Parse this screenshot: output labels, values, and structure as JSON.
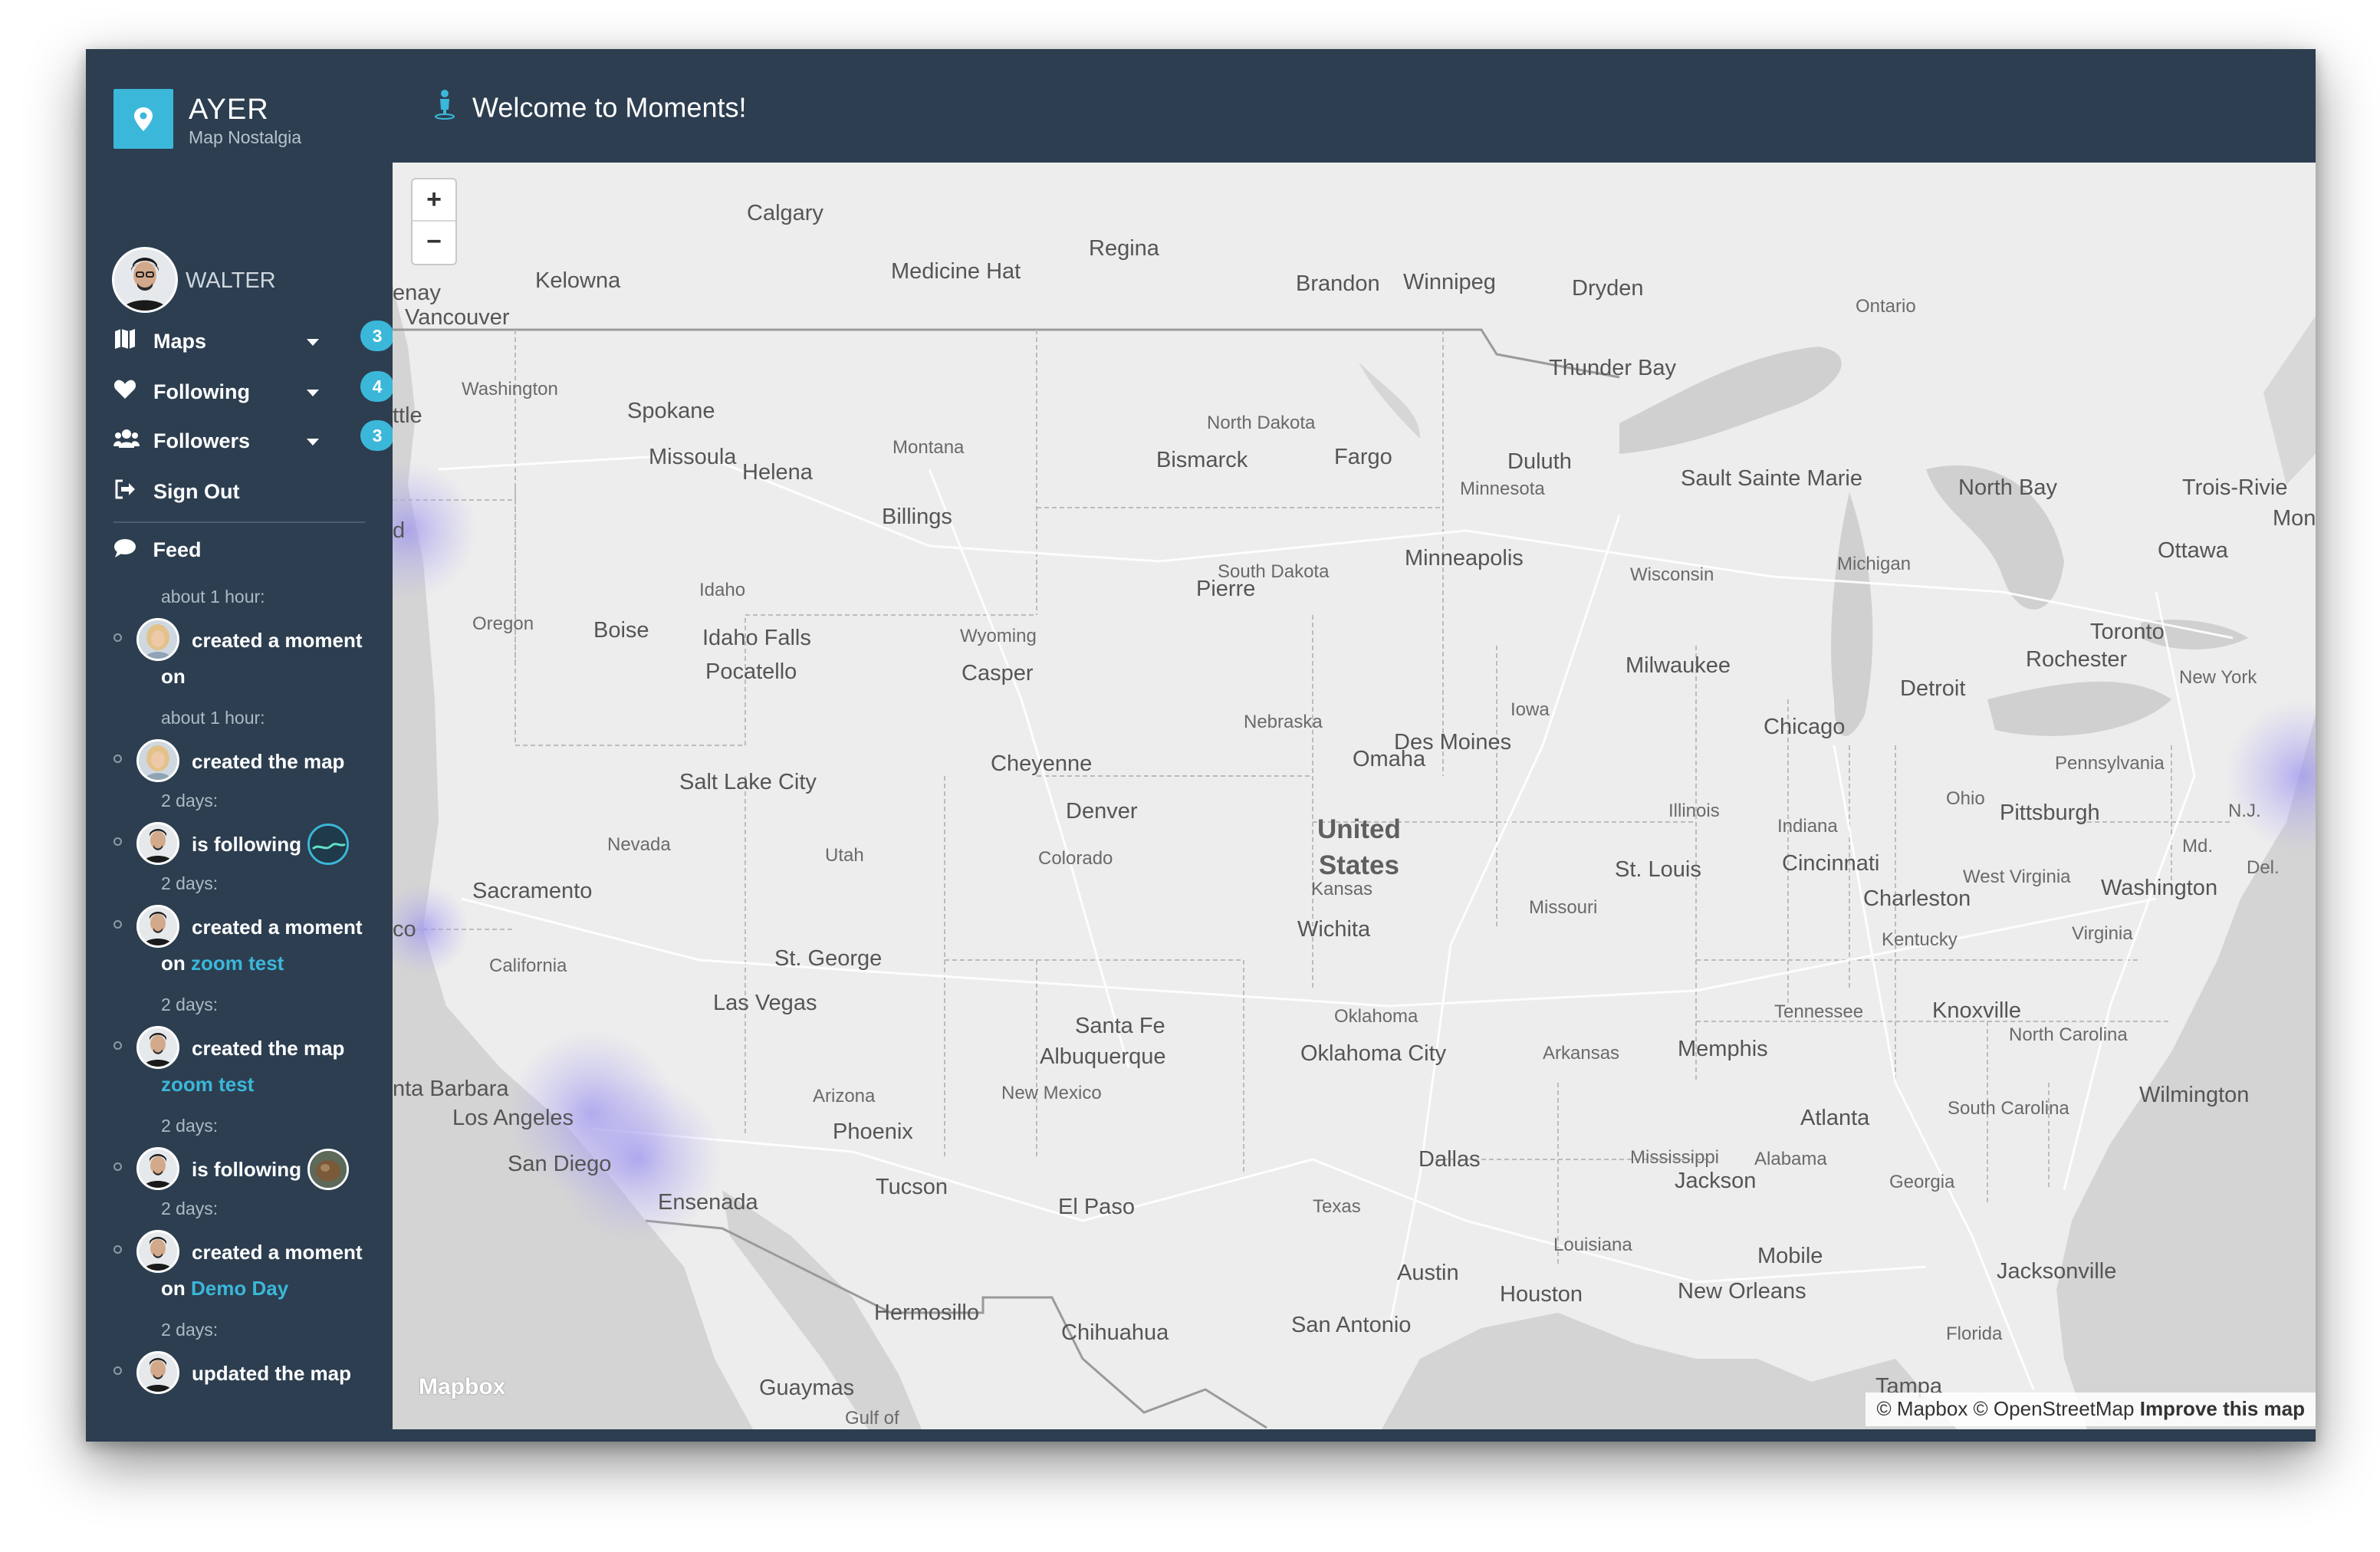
{
  "brand": {
    "title": "AYER",
    "subtitle": "Map Nostalgia"
  },
  "header": {
    "title": "Welcome to Moments!",
    "icon": "person-icon"
  },
  "user": {
    "name": "WALTER"
  },
  "nav": [
    {
      "label": "Maps",
      "icon": "map-icon",
      "badge": "3",
      "has_dropdown": true
    },
    {
      "label": "Following",
      "icon": "heart-icon",
      "badge": "4",
      "has_dropdown": true
    },
    {
      "label": "Followers",
      "icon": "users-icon",
      "badge": "3",
      "has_dropdown": true
    },
    {
      "label": "Sign Out",
      "icon": "sign-out-icon"
    }
  ],
  "feed": {
    "title": "Feed",
    "entries": [
      {
        "time": "about 1 hour:",
        "text": "created a moment",
        "line2": "on",
        "link": ""
      },
      {
        "time": "about 1 hour:",
        "text": "created the map",
        "line2": "",
        "link": ""
      },
      {
        "time": "2 days:",
        "text": "is following",
        "line2": "",
        "link": ""
      },
      {
        "time": "2 days:",
        "text": "created a moment",
        "line2": "on ",
        "link": "zoom test"
      },
      {
        "time": "2 days:",
        "text": "created the map",
        "line2": "",
        "link": "zoom test"
      },
      {
        "time": "2 days:",
        "text": "is following",
        "line2": "",
        "link": ""
      },
      {
        "time": "2 days:",
        "text": "created a moment",
        "line2": "on ",
        "link": "Demo Day"
      },
      {
        "time": "2 days:",
        "text": "updated the map",
        "line2": "",
        "link": ""
      }
    ]
  },
  "map": {
    "zoom_in": "+",
    "zoom_out": "−",
    "country_line1": "United",
    "country_line2": "States",
    "logo": "Mapbox",
    "attribution_prefix": "© Mapbox © OpenStreetMap",
    "attribution_link": "Improve this map",
    "colors": {
      "background": "#ededed",
      "water": "#d4d4d4",
      "heat": "#b9b3f0"
    },
    "cities": [
      "Calgary",
      "Regina",
      "Kelowna",
      "Medicine Hat",
      "Brandon",
      "Winnipeg",
      "Dryden",
      "enay",
      "Vancouver",
      "Thunder Bay",
      "Spokane",
      "ttle",
      "Missoula",
      "Helena",
      "Bismarck",
      "Fargo",
      "Duluth",
      "Sault Sainte Marie",
      "North Bay",
      "Trois-Rivie",
      "Mon",
      "Ottawa",
      "d",
      "Billings",
      "Minneapolis",
      "Pierre",
      "Boise",
      "Idaho Falls",
      "Pocatello",
      "Casper",
      "Milwaukee",
      "Toronto",
      "Rochester",
      "Detroit",
      "Chicago",
      "Des Moines",
      "Omaha",
      "Cheyenne",
      "Salt Lake City",
      "Denver",
      "Pittsburgh",
      "Sacramento",
      "St. Louis",
      "Cincinnati",
      "Washington",
      "Charleston",
      "co",
      "Wichita",
      "St. George",
      "Las Vegas",
      "Knoxville",
      "Santa Fe",
      "Albuquerque",
      "Oklahoma City",
      "Memphis",
      "nta Barbara",
      "Los Angeles",
      "Wilmington",
      "Atlanta",
      "Phoenix",
      "San Diego",
      "Dallas",
      "Jackson",
      "Ensenada",
      "Tucson",
      "El Paso",
      "Mobile",
      "Jacksonville",
      "Austin",
      "Houston",
      "New Orleans",
      "San Antonio",
      "Hermosillo",
      "Chihuahua",
      "Guaymas",
      "Tampa"
    ],
    "regions": [
      "Ontario",
      "Washington",
      "North Dakota",
      "Montana",
      "Minnesota",
      "South Dakota",
      "Wisconsin",
      "Michigan",
      "Oregon",
      "Idaho",
      "Wyoming",
      "New York",
      "Nebraska",
      "Iowa",
      "Pennsylvania",
      "Illinois",
      "Ohio",
      "Indiana",
      "N.J.",
      "Nevada",
      "Utah",
      "Colorado",
      "Kansas",
      "Md.",
      "Del.",
      "West Virginia",
      "Missouri",
      "California",
      "Kentucky",
      "Virginia",
      "Tennessee",
      "Oklahoma",
      "North Carolina",
      "Arkansas",
      "Arizona",
      "New Mexico",
      "South Carolina",
      "Mississippi",
      "Alabama",
      "Georgia",
      "Texas",
      "Louisiana",
      "Florida",
      "Gulf of"
    ]
  }
}
